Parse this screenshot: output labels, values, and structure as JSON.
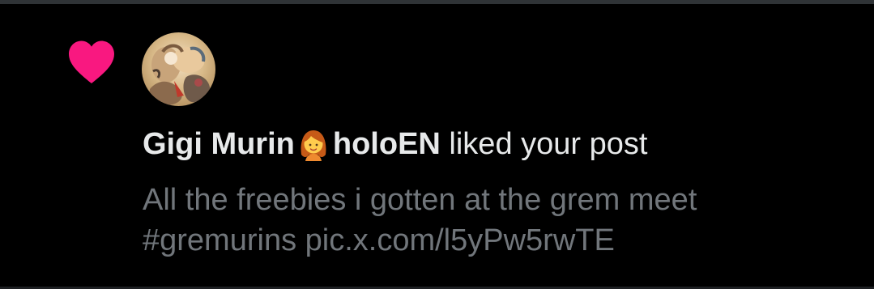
{
  "notification": {
    "type_icon": "heart-icon",
    "avatar_icon": "avatar-image",
    "user": {
      "display_name_part1": "Gigi Murin",
      "name_emoji": "woman-emoji",
      "display_name_part2": "holoEN"
    },
    "action_text": "liked your post",
    "post": {
      "line1": "All the freebies i gotten at the grem meet",
      "hashtag": "#gremurins",
      "link": "pic.x.com/l5yPw5rwTE"
    }
  },
  "colors": {
    "background": "#000000",
    "heart": "#f91880",
    "primary_text": "#e7e9ea",
    "secondary_text": "#71767b"
  }
}
